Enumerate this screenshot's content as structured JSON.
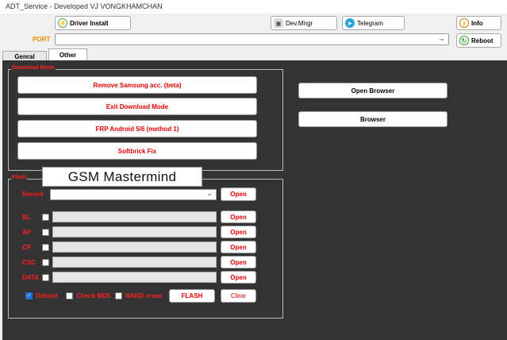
{
  "window": {
    "title": "ADT_Service - Developed VJ VONGKHAMCHAN"
  },
  "toolbar": {
    "driver_install": "Driver Install",
    "dev_mngr": "Dev.Mngr",
    "telegram": "Telegram",
    "info": "Info",
    "reboot": "Reboot"
  },
  "port": {
    "label": "PORT",
    "value": ""
  },
  "tabs": [
    {
      "label": "Genral"
    },
    {
      "label": "Other"
    }
  ],
  "download_mode": {
    "title": "Download Mode",
    "buttons": [
      "Remove Samsung acc. (beta)",
      "Exit Download Mode",
      "FRP Android 5/6 (method 1)",
      "Softbrick Fix"
    ]
  },
  "side_buttons": {
    "open_browser": "Open Browser",
    "browser": "Browser"
  },
  "flash": {
    "title": "Flash",
    "recent_label": "Recent",
    "open_label": "Open",
    "rows": [
      {
        "label": "BL"
      },
      {
        "label": "AP"
      },
      {
        "label": "CP"
      },
      {
        "label": "CSC"
      },
      {
        "label": "DATA"
      }
    ],
    "options": {
      "reboot": "Reboot",
      "check_md5": "Check MD5",
      "nand_erase": "NAND erase"
    },
    "flash_button": "FLASH",
    "clear_button": "Clear"
  },
  "watermark": "GSM Mastermind",
  "colors": {
    "panel": "#333333",
    "accent_red": "#e00000",
    "port_label": "#f08a00"
  },
  "icons": {
    "driver": "lightning-icon",
    "devmngr": "device-manager-icon",
    "telegram": "telegram-icon",
    "info": "info-icon",
    "reboot": "reboot-icon"
  }
}
